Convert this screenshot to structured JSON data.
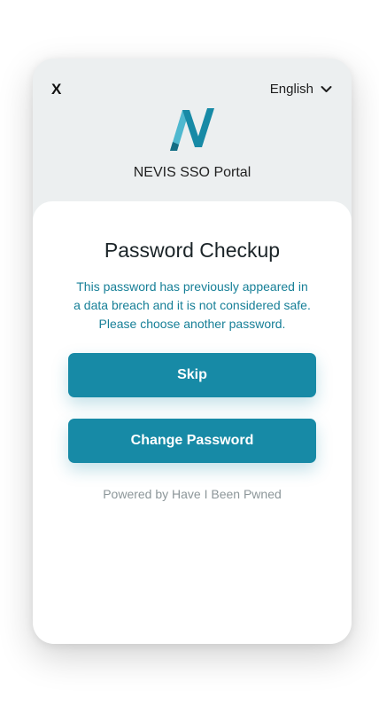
{
  "header": {
    "close_label": "X",
    "language": "English",
    "portal_title": "NEVIS SSO Portal"
  },
  "card": {
    "title": "Password Checkup",
    "warning_line1": "This password has previously appeared in",
    "warning_line2": "a data breach and it is not considered safe.",
    "warning_line3": "Please choose another password.",
    "skip_label": "Skip",
    "change_label": "Change Password",
    "powered_by": "Powered by Have I Been Pwned"
  },
  "colors": {
    "accent": "#178aa6",
    "warning_text": "#167f97",
    "header_bg": "#eceff0",
    "logo_primary": "#178aa6",
    "logo_light": "#4fb8cf"
  },
  "icons": {
    "language_toggle": "chevron-down-icon",
    "brand": "nevis-logo"
  }
}
